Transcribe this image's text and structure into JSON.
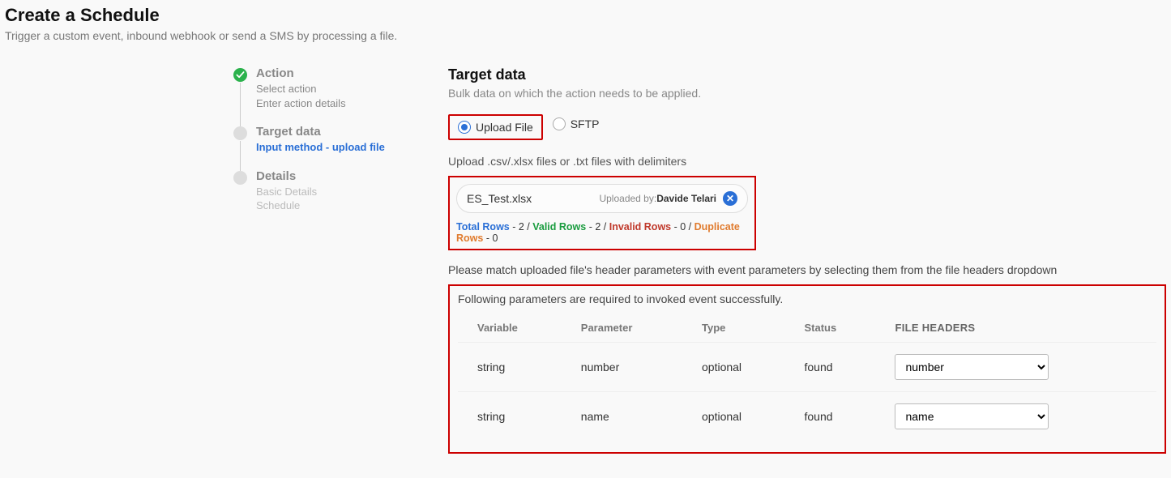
{
  "page": {
    "title": "Create a Schedule",
    "subtitle": "Trigger a custom event, inbound webhook or send a SMS by processing a file."
  },
  "stepper": {
    "steps": [
      {
        "title": "Action",
        "subs": [
          {
            "text": "Select action",
            "cls": ""
          },
          {
            "text": "Enter action details",
            "cls": ""
          }
        ],
        "state": "done"
      },
      {
        "title": "Target data",
        "subs": [
          {
            "text": "Input method - upload file",
            "cls": "active"
          }
        ],
        "state": "current"
      },
      {
        "title": "Details",
        "subs": [
          {
            "text": "Basic Details",
            "cls": "muted"
          },
          {
            "text": "Schedule",
            "cls": "muted"
          }
        ],
        "state": "pending"
      }
    ]
  },
  "target": {
    "title": "Target data",
    "subtitle": "Bulk data on which the action needs to be applied.",
    "radios": {
      "upload": "Upload File",
      "sftp": "SFTP",
      "selected": "upload"
    },
    "upload_hint": "Upload .csv/.xlsx files or .txt files with delimiters",
    "file": {
      "name": "ES_Test.xlsx",
      "uploaded_by_label": "Uploaded by:",
      "uploaded_by": "Davide Telari"
    },
    "stats": {
      "total_label": "Total Rows",
      "total": "2",
      "valid_label": "Valid Rows",
      "valid": "2",
      "invalid_label": "Invalid Rows",
      "invalid": "0",
      "dup_label": "Duplicate Rows",
      "dup": "0"
    },
    "match_hint": "Please match uploaded file's header parameters with event parameters by selecting them from the file headers dropdown",
    "params_intro": "Following parameters are required to invoked event successfully.",
    "columns": {
      "variable": "Variable",
      "parameter": "Parameter",
      "type": "Type",
      "status": "Status",
      "file_headers": "FILE HEADERS"
    },
    "rows": [
      {
        "variable": "string",
        "parameter": "number",
        "type": "optional",
        "status": "found",
        "header": "number"
      },
      {
        "variable": "string",
        "parameter": "name",
        "type": "optional",
        "status": "found",
        "header": "name"
      }
    ],
    "header_options": [
      "number",
      "name"
    ]
  }
}
